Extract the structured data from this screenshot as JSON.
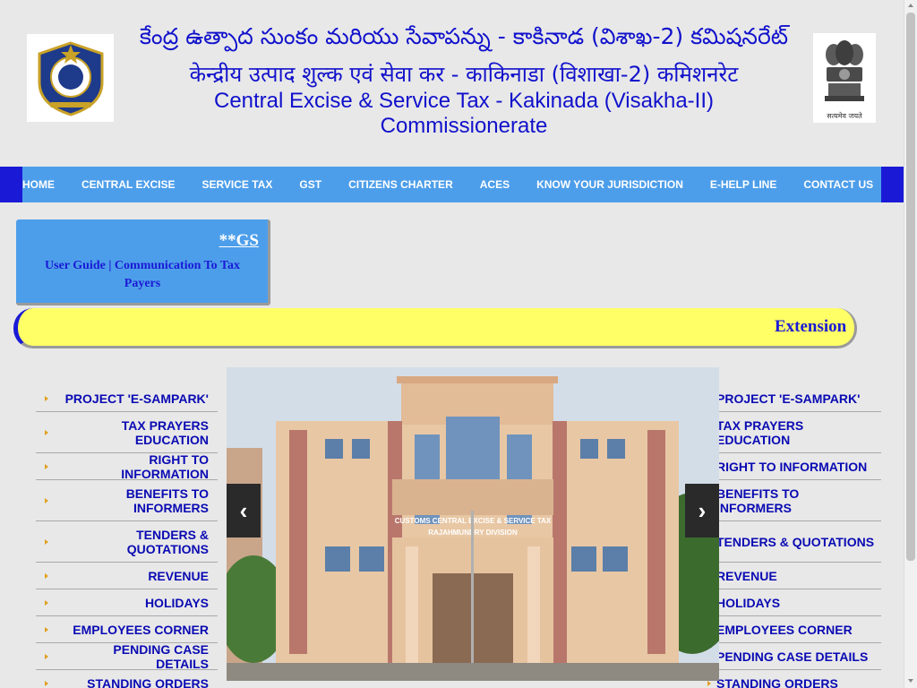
{
  "header": {
    "title_telugu": "కేంద్ర ఉత్పాద సుంకం మరియు సేవాపన్ను - కాకినాడ (విశాఖ-2) కమిషనరేట్",
    "title_hindi": "केन्द्रीय उत्पाद शुल्क एवं सेवा कर - काकिनाडा (विशाखा-2) कमिशनरेट",
    "title_english_1": "Central Excise & Service Tax - Kakinada (Visakha-II)",
    "title_english_2": "Commissionerate",
    "emblem_caption": "सत्यमेव जयते"
  },
  "nav": {
    "items": [
      "HOME",
      "CENTRAL EXCISE",
      "SERVICE TAX",
      "GST",
      "CITIZENS CHARTER",
      "ACES",
      "KNOW YOUR JURISDICTION",
      "E-HELP LINE",
      "CONTACT US"
    ]
  },
  "gst_box": {
    "heading": "**GS",
    "link_user_guide": "User Guide",
    "separator": " | ",
    "link_communication_1": "Communication To Tax",
    "link_communication_2": "Payers"
  },
  "marquee": {
    "text": "Extension of"
  },
  "menu_left": [
    {
      "label": "PROJECT 'E-SAMPARK'"
    },
    {
      "label": "TAX PRAYERS EDUCATION"
    },
    {
      "label": "RIGHT TO INFORMATION"
    },
    {
      "label": "BENEFITS TO INFORMERS"
    },
    {
      "label": "TENDERS & QUOTATIONS"
    },
    {
      "label": "REVENUE"
    },
    {
      "label": "HOLIDAYS"
    },
    {
      "label": "EMPLOYEES CORNER"
    },
    {
      "label": "PENDING CASE DETAILS"
    },
    {
      "label": "STANDING ORDERS"
    }
  ],
  "menu_right": [
    {
      "label": "PROJECT 'E-SAMPARK'"
    },
    {
      "label": "TAX PRAYERS EDUCATION"
    },
    {
      "label": "RIGHT TO INFORMATION"
    },
    {
      "label": "BENEFITS TO INFORMERS"
    },
    {
      "label": "TENDERS & QUOTATIONS"
    },
    {
      "label": "REVENUE"
    },
    {
      "label": "HOLIDAYS"
    },
    {
      "label": "EMPLOYEES CORNER"
    },
    {
      "label": "PENDING CASE DETAILS"
    },
    {
      "label": "STANDING ORDERS"
    }
  ],
  "carousel": {
    "building_sign_line1": "CUSTOMS CENTRAL EXCISE & SERVICE TAX",
    "building_sign_line2": "RAJAHMUNDRY DIVISION",
    "prev_glyph": "‹",
    "next_glyph": "›"
  },
  "icons": {
    "left_logo": "cbec-emblem-icon",
    "right_logo": "ashoka-emblem-icon",
    "bullet": "triangle-bullet-icon"
  },
  "colors": {
    "title_blue": "#1111cc",
    "nav_blue": "#4d9eea",
    "nav_edge": "#1a1ad6",
    "marquee_yellow": "#ffff66",
    "bullet_orange": "#e0a020"
  }
}
